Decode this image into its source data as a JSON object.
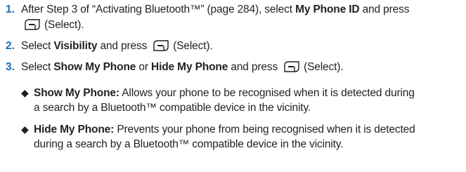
{
  "steps": [
    {
      "number": "1.",
      "line1_a": "After Step 3 of “Activating Bluetooth™” (page 284), select ",
      "line1_bold": "My Phone ID",
      "line1_b": " and press",
      "line2_after_key": "(Select)."
    },
    {
      "number": "2.",
      "a": "Select ",
      "bold": "Visibility",
      "b": " and press",
      "after_key": "(Select)."
    },
    {
      "number": "3.",
      "a": "Select ",
      "bold1": "Show My Phone",
      "mid": " or ",
      "bold2": "Hide My Phone",
      "b": " and press",
      "after_key": "(Select)."
    }
  ],
  "bullets": [
    {
      "marker": "◆",
      "term": "Show My Phone:",
      "line1": " Allows your phone to be recognised when it is detected during",
      "line2": "a search by a Bluetooth™ compatible device in the vicinity."
    },
    {
      "marker": "◆",
      "term": "Hide My Phone:",
      "line1": " Prevents your phone from being recognised when it is detected",
      "line2": "during a search by a Bluetooth™ compatible device in the vicinity."
    }
  ],
  "icons": {
    "select_key": "left-softkey-icon"
  },
  "colors": {
    "step_number": "#1b6ab3",
    "text": "#231f20"
  }
}
